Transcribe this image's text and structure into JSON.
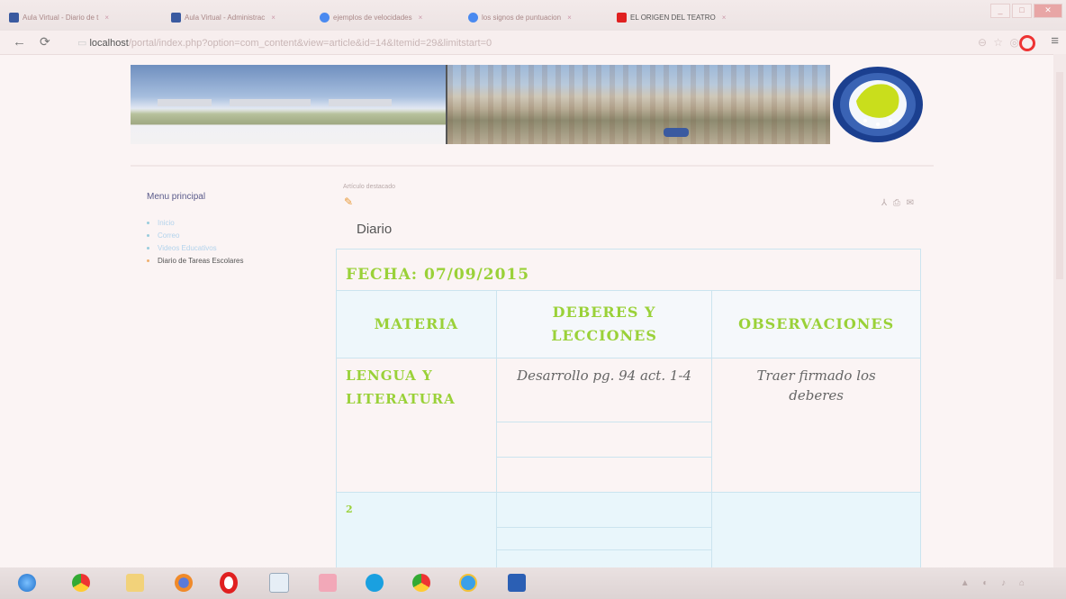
{
  "browser": {
    "tabs": [
      {
        "title": "Aula Virtual - Diario de t",
        "favicon_color": "#3a5aa0",
        "active": false
      },
      {
        "title": "Aula Virtual - Administrac",
        "favicon_color": "#3a5aa0",
        "active": false
      },
      {
        "title": "ejemplos de velocidades",
        "favicon_color": "#4a8af0",
        "active": false
      },
      {
        "title": "los signos de puntuacion",
        "favicon_color": "#4a8af0",
        "active": false
      },
      {
        "title": "EL ORIGEN DEL TEATRO",
        "favicon_color": "#e02020",
        "active": true
      }
    ],
    "url_host": "localhost",
    "url_path": "/portal/index.php?option=com_content&view=article&id=14&Itemid=29&limitstart=0",
    "back_icon": "arrow-left-icon",
    "reload_icon": "reload-icon"
  },
  "sidebar": {
    "title": "Menu principal",
    "items": [
      {
        "label": "Inicio"
      },
      {
        "label": "Correo"
      },
      {
        "label": "Videos Educativos"
      },
      {
        "label": "Diario de Tareas Escolares"
      }
    ]
  },
  "article": {
    "featured": "Artículo destacado",
    "title": "Diario",
    "actions": "pdf-icon print-icon email-icon"
  },
  "diary": {
    "date_label": "FECHA: 07/09/2015",
    "columns": [
      "MATERIA",
      "DEBERES Y LECCIONES",
      "OBSERVACIONES"
    ],
    "rows": [
      {
        "subject": "LENGUA Y LITERATURA",
        "task": "Desarrollo pg. 94 act. 1-4",
        "observation": "Traer firmado los deberes"
      },
      {
        "subject": "2",
        "task": "",
        "observation": ""
      }
    ]
  },
  "colors": {
    "accent_green": "#9ad138",
    "table_border": "#cbe4ef",
    "link_blue": "#b3d3ec"
  },
  "taskbar": {
    "icons": [
      "start-orb-icon",
      "chrome-icon",
      "folder-icon",
      "firefox-icon",
      "opera-icon",
      "hp-icon",
      "paint-icon",
      "skype-icon",
      "chrome-icon",
      "ie-icon",
      "word-icon"
    ]
  }
}
